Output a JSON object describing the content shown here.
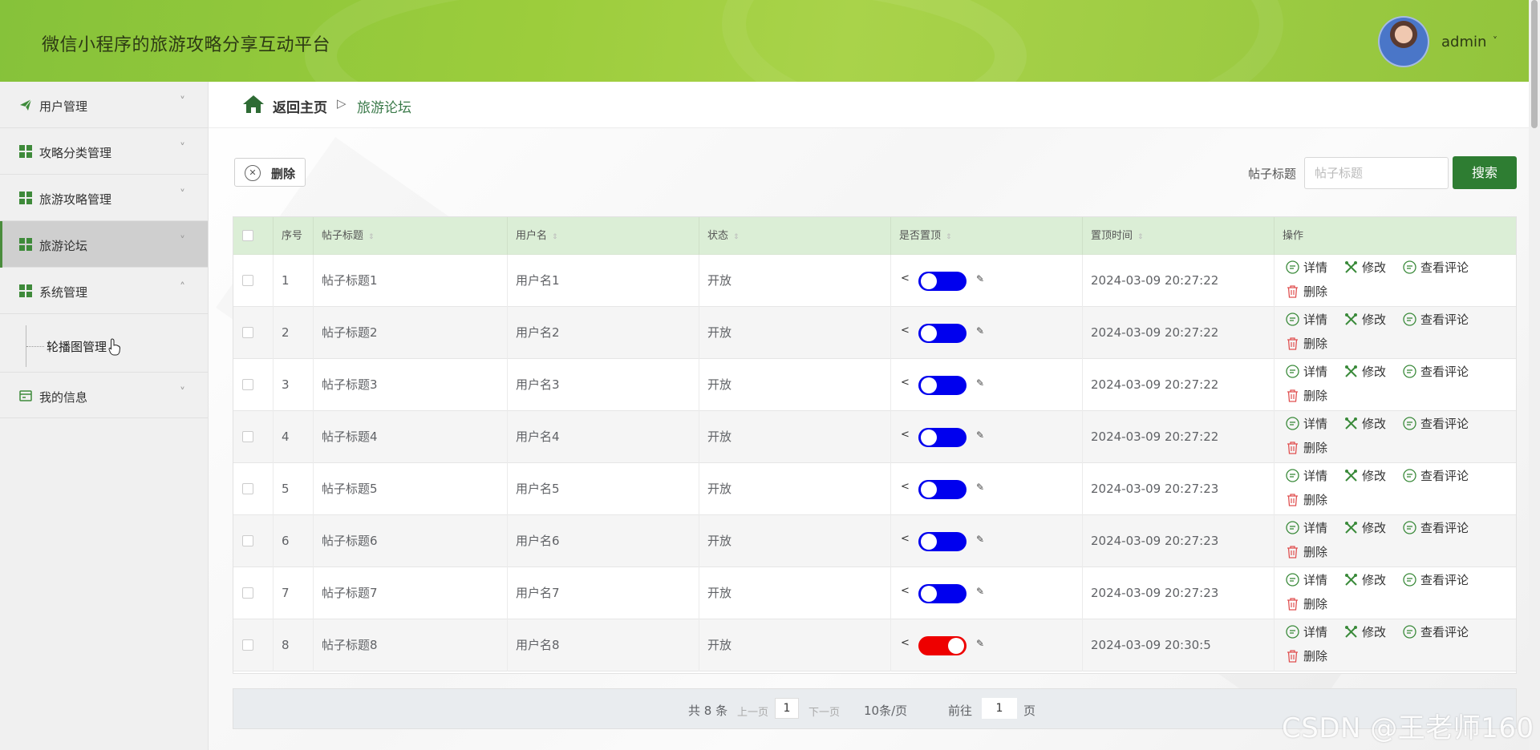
{
  "header": {
    "title": "微信小程序的旅游攻略分享互动平台",
    "username": "admin",
    "dropdown_arrow": "˅"
  },
  "sidebar": {
    "items": [
      {
        "label": "用户管理",
        "icon": "paper-plane-icon",
        "chevron": "˅"
      },
      {
        "label": "攻略分类管理",
        "icon": "grid-icon",
        "chevron": "˅"
      },
      {
        "label": "旅游攻略管理",
        "icon": "grid-icon",
        "chevron": "˅"
      },
      {
        "label": "旅游论坛",
        "icon": "grid-icon",
        "chevron": "˅",
        "active": true
      },
      {
        "label": "系统管理",
        "icon": "grid-icon",
        "chevron": "˄",
        "expanded": true
      },
      {
        "label": "我的信息",
        "icon": "card-icon",
        "chevron": "˅"
      }
    ],
    "sub_item": "轮播图管理"
  },
  "breadcrumb": {
    "home": "返回主页",
    "separator": "▷",
    "current": "旅游论坛"
  },
  "toolbar": {
    "delete_label": "删除",
    "search_label": "帖子标题",
    "search_placeholder": "帖子标题",
    "search_button": "搜索"
  },
  "table": {
    "columns": [
      "序号",
      "帖子标题",
      "用户名",
      "状态",
      "是否置顶",
      "置顶时间",
      "操作"
    ],
    "sort_glyph": "⇕",
    "actions": {
      "detail": "详情",
      "edit": "修改",
      "comments": "查看评论",
      "delete": "删除"
    },
    "rows": [
      {
        "no": "1",
        "title": "帖子标题1",
        "user": "用户名1",
        "status": "开放",
        "pinned": false,
        "time": "2024-03-09 20:27:22"
      },
      {
        "no": "2",
        "title": "帖子标题2",
        "user": "用户名2",
        "status": "开放",
        "pinned": false,
        "time": "2024-03-09 20:27:22"
      },
      {
        "no": "3",
        "title": "帖子标题3",
        "user": "用户名3",
        "status": "开放",
        "pinned": false,
        "time": "2024-03-09 20:27:22"
      },
      {
        "no": "4",
        "title": "帖子标题4",
        "user": "用户名4",
        "status": "开放",
        "pinned": false,
        "time": "2024-03-09 20:27:22"
      },
      {
        "no": "5",
        "title": "帖子标题5",
        "user": "用户名5",
        "status": "开放",
        "pinned": false,
        "time": "2024-03-09 20:27:23"
      },
      {
        "no": "6",
        "title": "帖子标题6",
        "user": "用户名6",
        "status": "开放",
        "pinned": false,
        "time": "2024-03-09 20:27:23"
      },
      {
        "no": "7",
        "title": "帖子标题7",
        "user": "用户名7",
        "status": "开放",
        "pinned": false,
        "time": "2024-03-09 20:27:23"
      },
      {
        "no": "8",
        "title": "帖子标题8",
        "user": "用户名8",
        "status": "开放",
        "pinned": true,
        "time": "2024-03-09 20:30:5"
      }
    ],
    "toggle_colors": {
      "off": "#0000ee",
      "on": "#ee0000"
    }
  },
  "pagination": {
    "total": "共 8 条",
    "prev": "上一页",
    "page": "1",
    "next": "下一页",
    "page_size": "10条/页",
    "goto_prefix": "前往",
    "goto_value": "1",
    "goto_suffix": "页"
  },
  "watermark": "CSDN @王老师160",
  "colors": {
    "header_green": "#9ccd3c",
    "primary_green": "#2e7d32",
    "table_header": "#dbeed6"
  }
}
